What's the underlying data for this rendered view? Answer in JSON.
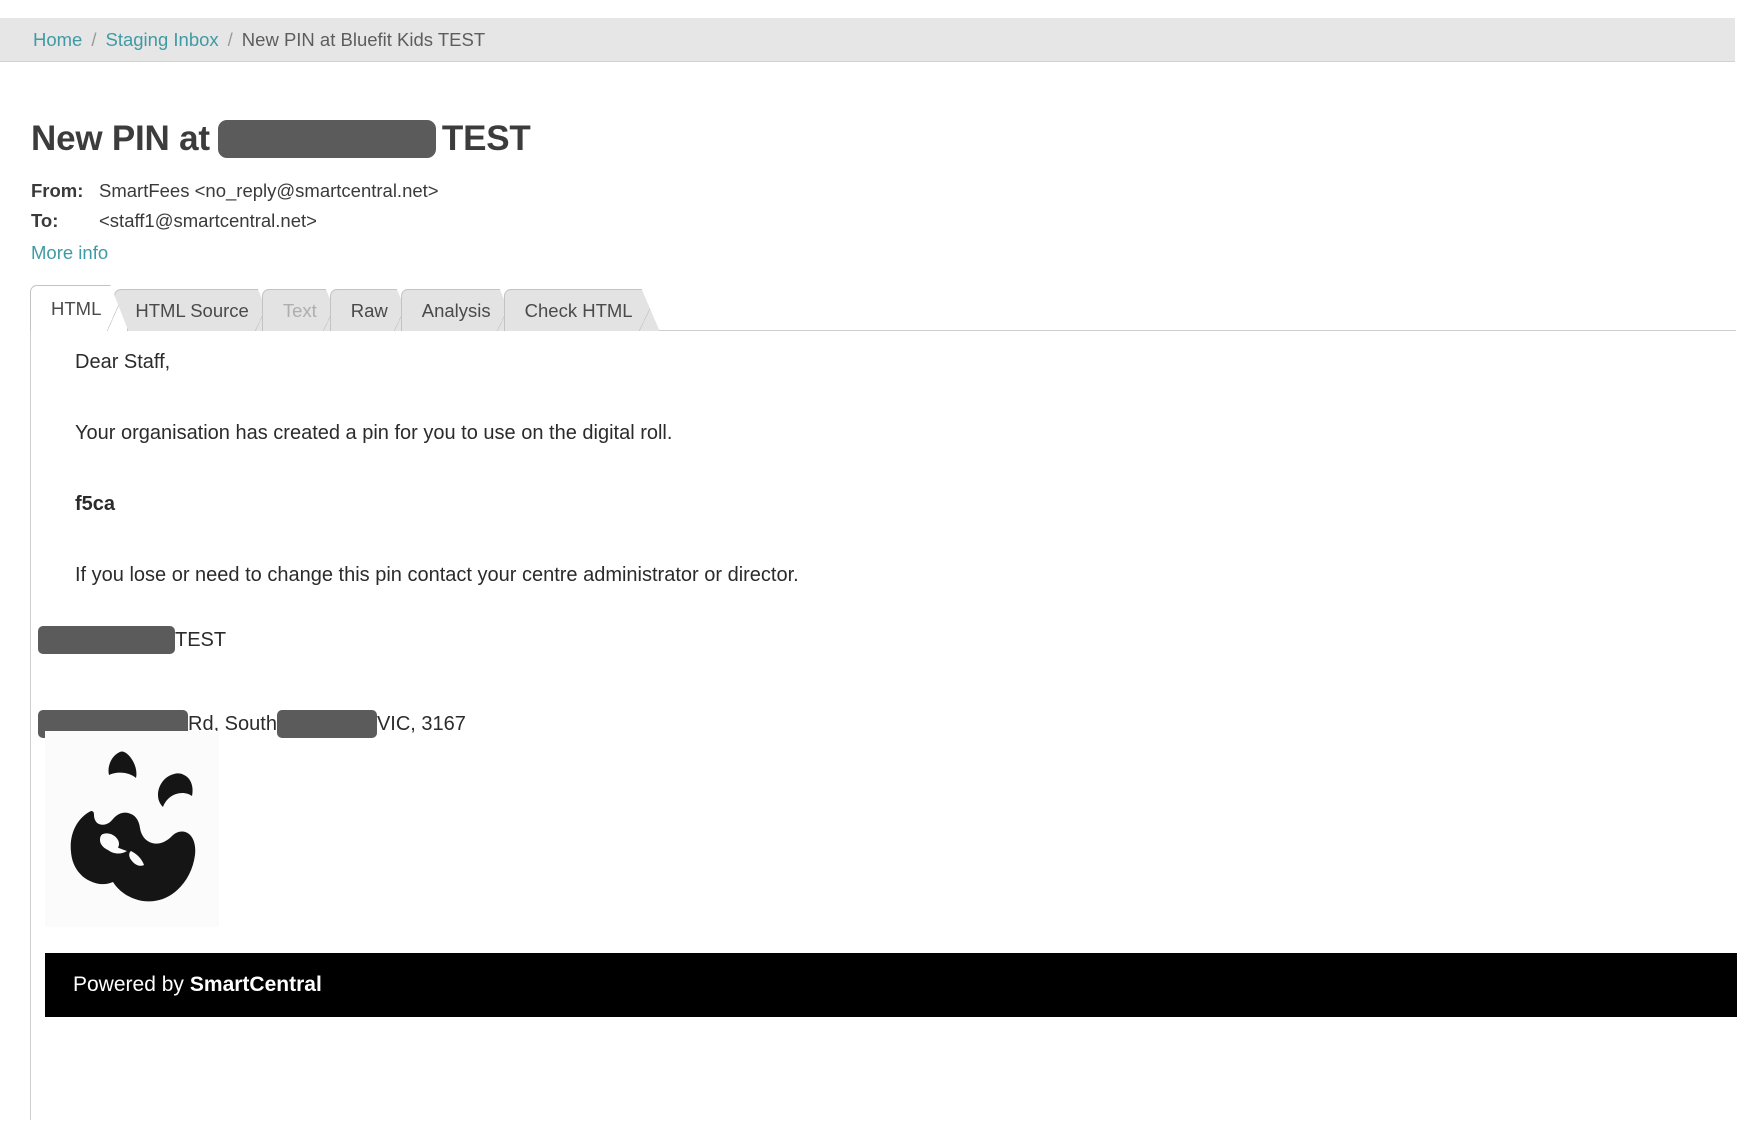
{
  "breadcrumb": {
    "home": "Home",
    "separator": "/",
    "inbox": "Staging Inbox",
    "current": "New PIN at Bluefit Kids TEST"
  },
  "page": {
    "title_prefix": "New PIN at",
    "title_suffix": "TEST"
  },
  "meta": {
    "from_label": "From:",
    "from_value": "SmartFees <no_reply@smartcentral.net>",
    "to_label": "To:",
    "to_value": "<staff1@smartcentral.net>",
    "more_info": "More info"
  },
  "tabs": [
    {
      "label": "HTML",
      "state": "active"
    },
    {
      "label": "HTML Source",
      "state": "normal"
    },
    {
      "label": "Text",
      "state": "disabled"
    },
    {
      "label": "Raw",
      "state": "normal"
    },
    {
      "label": "Analysis",
      "state": "normal"
    },
    {
      "label": "Check HTML",
      "state": "normal"
    }
  ],
  "email": {
    "greeting": "Dear Staff,",
    "intro": "Your organisation has created a pin for you to use on the digital roll.",
    "pin": "f5ca",
    "closing": "If you lose or need to change this pin contact your centre administrator or director.",
    "org_suffix": "TEST",
    "address_part1": "Rd, South",
    "address_part2": "VIC, 3167",
    "logo_alt": "panda-logo",
    "powered_prefix": "Powered by",
    "powered_brand": "SmartCentral"
  },
  "colors": {
    "link": "#3f9ba3",
    "breadcrumb_bg": "#e6e6e6",
    "tab_bg": "#e3e3e3",
    "redaction": "#5b5b5b",
    "footer_bg": "#000000"
  }
}
